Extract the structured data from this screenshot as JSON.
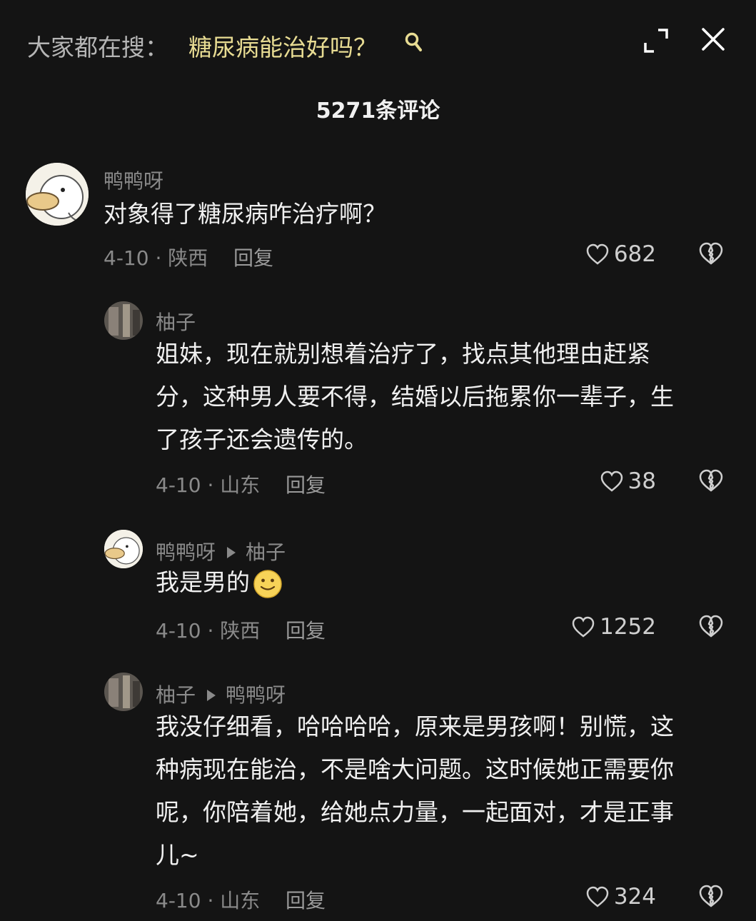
{
  "search": {
    "prefix": "大家都在搜：",
    "query": "糖尿病能治好吗？"
  },
  "header": {
    "count_label": "5271条评论"
  },
  "comments": [
    {
      "author": "鸭鸭呀",
      "text": "对象得了糖尿病咋治疗啊？",
      "meta": "4-10 · 陕西",
      "reply_label": "回复",
      "likes": "682",
      "avatar_icon": "duck-avatar"
    },
    {
      "author": "柚子",
      "text": "姐妹，现在就别想着治疗了，找点其他理由赶紧分，这种男人要不得，结婚以后拖累你一辈子，生了孩子还会遗传的。",
      "meta": "4-10 · 山东",
      "reply_label": "回复",
      "likes": "38",
      "avatar_icon": "photo-avatar"
    },
    {
      "author": "鸭鸭呀",
      "reply_to": "柚子",
      "text": "我是男的",
      "emoji": "smile-emoji",
      "meta": "4-10 · 陕西",
      "reply_label": "回复",
      "likes": "1252",
      "avatar_icon": "duck-avatar"
    },
    {
      "author": "柚子",
      "reply_to": "鸭鸭呀",
      "text": "我没仔细看，哈哈哈哈，原来是男孩啊！别慌，这种病现在能治，不是啥大问题。这时候她正需要你呢，你陪着她，给她点力量，一起面对，才是正事儿~",
      "meta": "4-10 · 山东",
      "reply_label": "回复",
      "likes": "324",
      "avatar_icon": "photo-avatar"
    }
  ],
  "colors": {
    "background": "#141414",
    "query_highlight": "#e8dc93",
    "secondary_text": "#8a8a8a"
  }
}
